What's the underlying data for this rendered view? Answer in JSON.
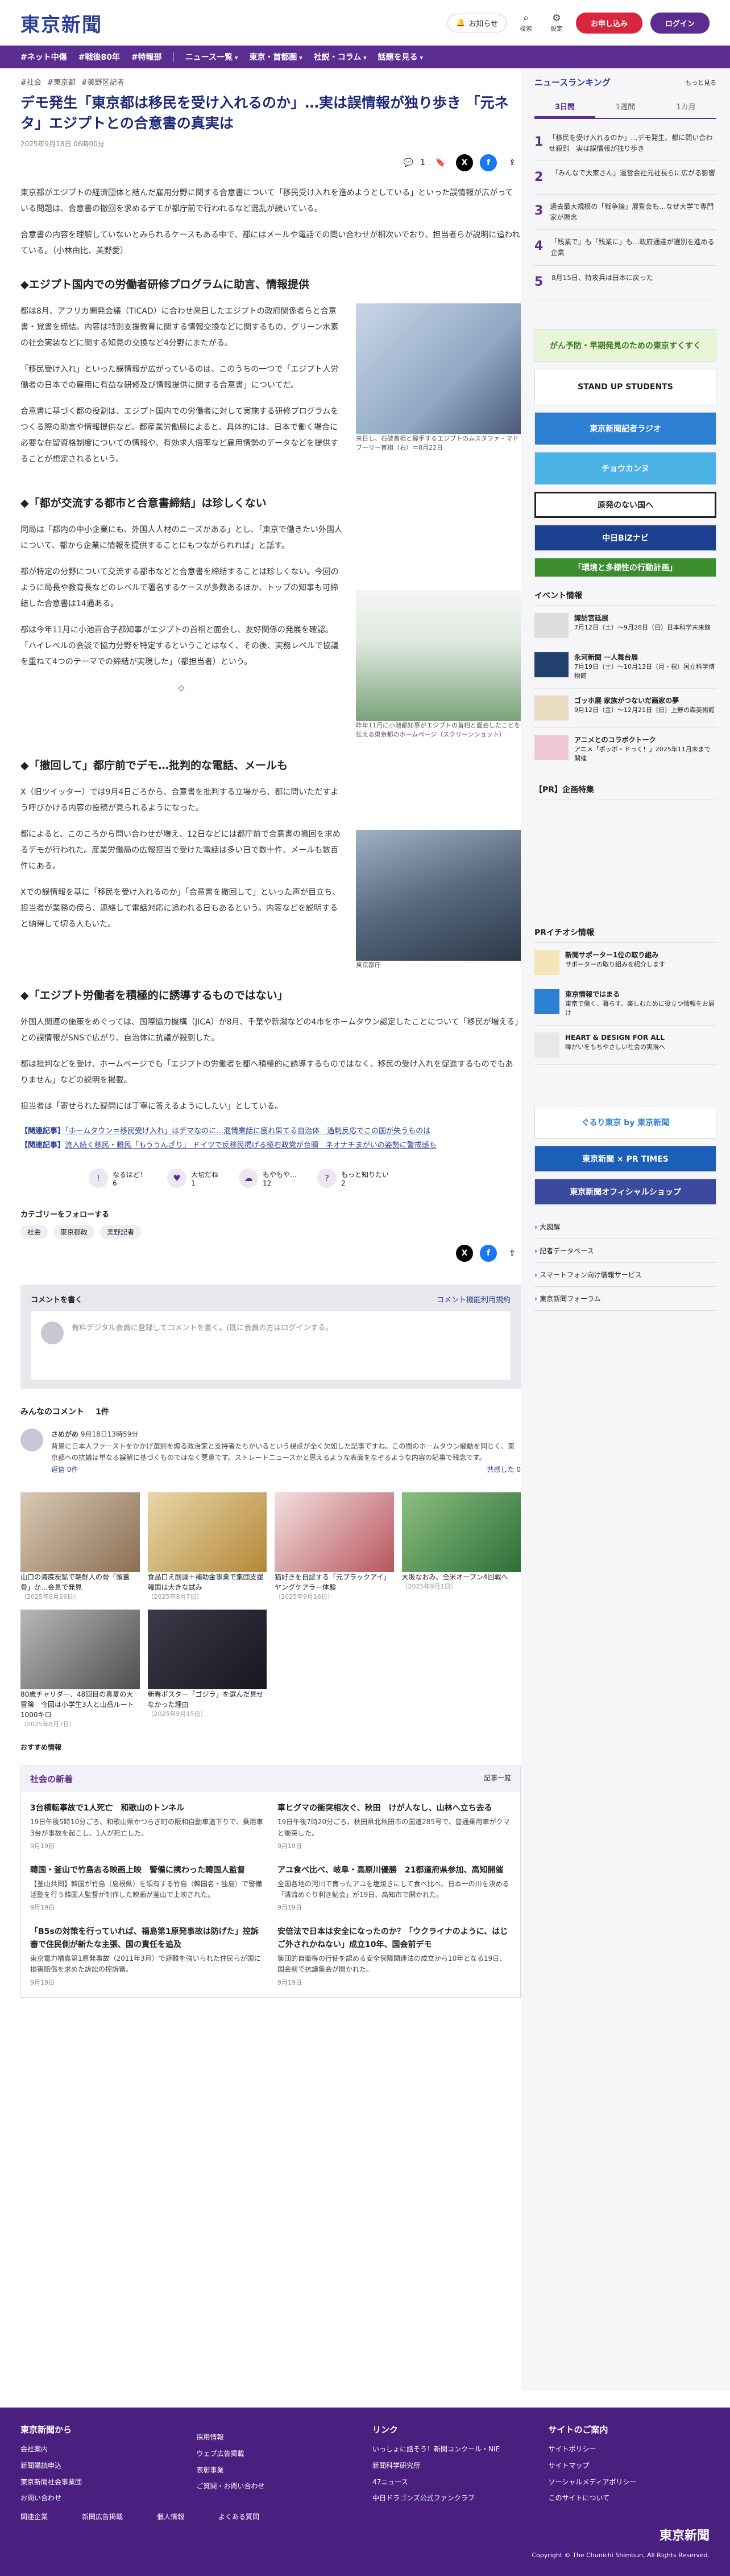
{
  "header": {
    "logo": "東京新聞",
    "notif": "お知らせ",
    "search": "検索",
    "settings": "設定",
    "mypage": "マイページ",
    "subscribe": "お申し込み",
    "login": "ログイン"
  },
  "nav": {
    "tags": [
      "#ネット中傷",
      "#戦後80年",
      "#特報部"
    ],
    "menus": [
      "ニュース一覧",
      "東京・首都圏",
      "社説・コラム",
      "話題を見る"
    ]
  },
  "article": {
    "tags": [
      "社会",
      "東京都",
      "美野区記者"
    ],
    "title": "デモ発生「東京都は移民を受け入れるのか」…実は誤情報が独り歩き 「元ネタ」エジプトとの合意書の真実は",
    "date": "2025年9月18日 06時00分",
    "comments": "1",
    "lead": [
      "東京都がエジプトの経済団体と結んだ雇用分野に関する合意書について「移民受け入れを進めようとしている」といった誤情報が広がっている問題は、合意書の撤回を求めるデモが都庁前で行われるなど混乱が続いている。",
      "合意書の内容を理解していないとみられるケースもある中で、都にはメールや電話での問い合わせが相次いでおり、担当者らが説明に追われている。（小林由比、美野愛）"
    ],
    "h1": "エジプト国内での労働者研修プログラムに助言、情報提供",
    "s1": [
      "都は8月、アフリカ開発会議（TICAD）に合わせ来日したエジプトの政府関係者らと合意書・覚書を締結。内容は特別支援教育に関する情報交換などに関するもの、グリーン水素の社会実装などに関する知見の交換など4分野にまたがる。",
      "「移民受け入れ」といった誤情報が広がっているのは、このうちの一つで「エジプト人労働者の日本での雇用に有益な研修及び情報提供に関する合意書」についてだ。",
      "合意書に基づく都の役割は、エジプト国内での労働者に対して実施する研修プログラムをつくる際の助言や情報提供など。都産業労働局によると、具体的には、日本で働く場合に必要な在留資格制度についての情報や、有効求人倍率など雇用情勢のデータなどを提供することが想定されるという。"
    ],
    "fig1": "来日し、石破首相と握手するエジプトのムスタファ・マドブーリー首相（右）＝8月22日",
    "h2": "「都が交流する都市と合意書締結」は珍しくない",
    "s2": [
      "同局は「都内の中小企業にも、外国人人材のニーズがある」とし、「東京で働きたい外国人について、都から企業に情報を提供することにもつながられれば」と話す。",
      "都が特定の分野について交流する都市などと合意書を締結することは珍しくない。今回のように局長や教育長などのレベルで署名するケースが多数あるほか、トップの知事も可締結した合意書は14通ある。",
      "都は今年11月に小池百合子都知事がエジプトの首相と面会し、友好関係の発展を確認。「ハイレベルの会談で協力分野を特定するということはなく、その後、実務レベルで協議を重ねて4つのテーマでの締結が実現した」（都担当者）という。",
      "◇"
    ],
    "h3": "「撤回して」都庁前でデモ…批判的な電話、メールも",
    "s3": [
      "X（旧ツイッター）では9月4日ごろから、合意書を批判する立場から、都に問いただすよう呼びかける内容の投稿が見られるようになった。",
      "都によると、このころから問い合わせが増え、12日などには都庁前で合意書の撤回を求めるデモが行われた。産業労働局の広報担当で受けた電話は多い日で数十件、メールも数百件にある。",
      "Xでの誤情報を基に「移民を受け入れるのか」「合意書を撤回して」といった声が目立ち、担当者が業務の傍ら、連絡して電話対応に追われる日もあるという。内容などを説明すると納得して切る人もいた。"
    ],
    "fig2": "昨年11月に小池都知事がエジプトの首相と面会したことを伝える東京都のホームページ（スクリーンショット）",
    "h4": "「エジプト労働者を積極的に誘導するものではない」",
    "s4": [
      "外国人関連の施策をめぐっては、国際協力機構（JICA）が8月、千葉や新潟などの4市をホームタウン認定したことについて「移民が増える」との誤情報がSNSで広がり、自治体に抗議が殺到した。",
      "都は批判などを受け、ホームページでも「エジプトの労働者を都へ積極的に誘導するものではなく、移民の受け入れを促進するものでもありません」などの説明を掲載。",
      "担当者は「寄せられた疑問には丁寧に答えるようにしたい」としている。"
    ],
    "fig3": "東京都庁",
    "rel_label": "【関連記事】",
    "rel1": "「ホームタウン＝移民受け入れ」はデマなのに…混情業話に疲れ果てる自治体　過剰反応でこの国が失うものは",
    "rel2": "流入続く移民・難民「もううんざり」 ドイツで反移民掲げる極右政党が台頭　ネオナチまがいの姿勢に警戒感も"
  },
  "reactions": [
    {
      "label": "なるほど！",
      "count": "6"
    },
    {
      "label": "大切だね",
      "count": "1"
    },
    {
      "label": "もやもや…",
      "count": "12"
    },
    {
      "label": "もっと知りたい",
      "count": "2"
    }
  ],
  "follow": {
    "label": "カテゴリーをフォローする",
    "chips": [
      "社会",
      "東京都政",
      "美野記者"
    ]
  },
  "comment_box": {
    "title": "コメントを書く",
    "rule": "コメント機能利用規約",
    "prompt": "有料デジタル会員に登録してコメントを書く。(既に会員の方はログインする。"
  },
  "comments": {
    "title": "みんなのコメント",
    "count": "1件",
    "user": "さめがめ",
    "date": "9月18日13時59分",
    "text": "背景に日本人ファーストをかかげ選別を煽る政治家と支持者たちがいるという視点が全く欠如した記事ですね。この間のホームタウン騒動を同じく、東京都への抗議は単なる誤解に基づくものではなく悪意です。ストレートニュースかと思えるような表面をなぞるような内容の記事で残念です。",
    "reply": "返信  0件",
    "helpful": "共感した 0"
  },
  "cards": [
    {
      "t": "山口の海底炭鉱で朝鮮人の骨「頭蓋骨」か…会見で発見",
      "d": "（2025年8月26日）"
    },
    {
      "t": "食品口え削減＋補助金事業で集団支援　韓国は大きな試み",
      "d": "（2025年8月7日）"
    },
    {
      "t": "猫好きを自認する「元ブラックアイ」ヤングケアラー体験",
      "d": "（2025年9月16日）"
    },
    {
      "t": "大坂なおみ、全米オープン4回戦へ",
      "d": "（2025年9月1日）"
    },
    {
      "t": "80歳チャリダー、48回目の真夏の大冒険　今回は小学生3人と山岳ルート1000キロ",
      "d": "（2025年8月7日）"
    },
    {
      "t": "新春ポスター「ゴジラ」を選んだ見せなかった理由",
      "d": "（2025年9月15日）"
    }
  ],
  "rec": "おすすめ情報",
  "news": {
    "title": "社会の新着",
    "more": "記事一覧",
    "items": [
      {
        "t": "3台横転事故で1人死亡　和歌山のトンネル",
        "b": "19日午後5時10分ごろ、和歌山県かつらぎ町の阪和自動車道下りで、乗用車3台が事故を起こし、1人が死亡した。",
        "d": "9月19日"
      },
      {
        "t": "車ヒグマの衝突相次ぐ、秋田　けが人なし、山林へ立ち去る",
        "b": "19日午後7時20分ごろ、秋田県北秋田市の国道285号で、普通乗用車がクマと衝突した。",
        "d": "9月19日"
      },
      {
        "t": "韓国・釜山で竹島志る映画上映　警備に携わった韓国人監督",
        "b": "【釜山共同】韓国が竹島（島根県）を領有する竹島（韓国名・独島）で警備活動を行う韓国人監督が制作した映画が釜山で上映された。",
        "d": "9月19日"
      },
      {
        "t": "アユ食べ比べ、岐阜・高原川優勝　21都道府県参加、高知開催",
        "b": "全国各地の河川で育ったアユを塩焼きにして食べ比べ、日本一の川を決める「清流めぐり利き鮎会」が19日、高知市で開かれた。",
        "d": "9月19日"
      },
      {
        "t": "「B5sの対策を行っていれば、福島第1原発事故は防げた」控訴審で住民側が新たな主張、国の責任を追及",
        "b": "東京電力福島第1原発事故（2011年3月）で避難を強いられた住民らが国に損害賠償を求めた訴訟の控訴審。",
        "d": "9月19日"
      },
      {
        "t": "安倍法で日本は安全になったのか？「ウクライナのように、はじご外されかねない」成立10年、国会前デモ",
        "b": "集団的自衛権の行使を認める安全保障関連法の成立から10年となる19日、国会前で抗議集会が開かれた。",
        "d": "9月19日"
      }
    ]
  },
  "ranking": {
    "title": "ニュースランキング",
    "more": "もっと見る",
    "tabs": [
      "3日間",
      "1週間",
      "1カ月"
    ],
    "items": [
      "「移民を受け入れるのか」…デモ発生、都に問い合わせ殺到　実は誤情報が独り歩き",
      "「みんなで大家さん」運営会社元社長らに広がる影響",
      "過去最大規模の「戦争論」展覧会も…なぜ大学で専門家が懸念",
      "「残業で」も「残業に」も…政府通達が選別を進める企業",
      "8月15日、特攻兵は日本に戻った"
    ]
  },
  "banners": [
    "がん予防・早期発見のための東京すくすく",
    "STAND UP STUDENTS",
    "東京新聞記者ラジオ",
    "チョウカンヌ",
    "原発のない国へ",
    "中日BiZナビ",
    "「環境と多様性の行動計画」"
  ],
  "events": {
    "title": "イベント情報",
    "items": [
      {
        "t": "諏訪宮廷展",
        "b": "7月12日（土）〜9月28日（日）日本科学未来館"
      },
      {
        "t": "永河新聞 一人舞台展",
        "b": "7月19日（土）〜10月13日（月・祝）国立科学博物館"
      },
      {
        "t": "ゴッホ展 家族がつないだ画家の夢",
        "b": "9月12日（金）〜12月21日（日）上野の森美術館"
      },
      {
        "t": "アニメとのコラボクトーク",
        "b": "アニメ「ポッポ・ドっく！」2025年11月末まで開催"
      }
    ]
  },
  "pr": {
    "title": "【PR】企画特集"
  },
  "pr2": {
    "title": "PRイチオシ情報",
    "items": [
      {
        "t": "新聞サポーター1位の取り組み",
        "b": "サポーターの取り組みを紹介します"
      },
      {
        "t": "東京情報ではまる",
        "b": "東京で働く、暮らす、楽しむために役立つ情報をお届け"
      },
      {
        "t": "HEART & DESIGN FOR ALL",
        "b": "障がいをもちやさしい社会の実現へ"
      }
    ]
  },
  "side_banners": [
    "ぐるり東京 by 東京新聞",
    "東京新聞 × PR TIMES",
    "東京新聞オフィシャルショップ"
  ],
  "side_links": [
    "大図解",
    "記者データベース",
    "スマートフォン向け情報サービス",
    "東京新聞フォーラム"
  ],
  "footer": {
    "col1": {
      "h": "東京新聞から",
      "items": [
        "会社案内",
        "新聞購読申込",
        "東京新聞社会事業団",
        "お問い合わせ"
      ]
    },
    "col2": {
      "h": "",
      "items": [
        "採用情報",
        "ウェブ広告掲載",
        "表彰事業",
        "ご質問・お問い合わせ"
      ]
    },
    "col3": {
      "h": "",
      "items": [
        "関連企業",
        "新聞広告掲載",
        "個人情報",
        "よくある質問"
      ]
    },
    "col4": {
      "h": "リンク",
      "items": [
        "いっしょに話そう！新聞コンクール・NIE",
        "新聞科学研究所",
        "47ニュース",
        "中日ドラゴンズ公式ファンクラブ"
      ]
    },
    "col5": {
      "h": "サイトのご案内",
      "items": [
        "サイトポリシー",
        "サイトマップ",
        "ソーシャルメディアポリシー",
        "このサイトについて"
      ]
    },
    "logo": "東京新聞",
    "copy": "Copyright © The Chunichi Shimbun, All Rights Reserved."
  }
}
